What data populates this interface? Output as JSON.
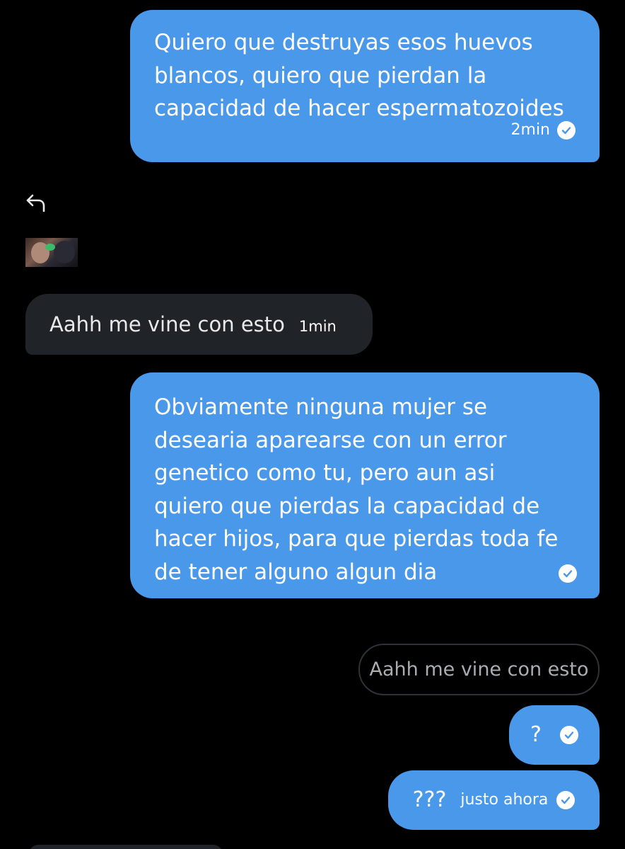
{
  "messages": [
    {
      "id": "msg1",
      "text": "Quiero que destruyas esos huevos blancos, quiero que pierdan la capacidad de hacer espermatozoides",
      "time": "2min",
      "status": "read-check-icon"
    },
    {
      "id": "msg2",
      "text": "Aahh me vine con esto",
      "time": "1min"
    },
    {
      "id": "msg3",
      "text": "Obviamente ninguna mujer se desearia aparearse con un error genetico como tu, pero aun asi quiero que pierdas la capacidad de hacer hijos, para que pierdas toda fe de tener alguno algun dia",
      "status": "read-check-icon"
    },
    {
      "id": "msg4",
      "quoted_text": "Aahh me vine con esto",
      "text": "?",
      "status": "read-check-icon"
    },
    {
      "id": "msg5",
      "text": "???",
      "time": "justo ahora",
      "status": "read-check-icon"
    }
  ],
  "icons": {
    "reply": "reply-arrow-icon",
    "thumbnail": "image-thumbnail",
    "check": "read-check-icon"
  },
  "colors": {
    "background": "#000000",
    "outgoing_bubble": "#4a98e9",
    "incoming_bubble": "#202327",
    "quote_border": "#2f3336"
  }
}
